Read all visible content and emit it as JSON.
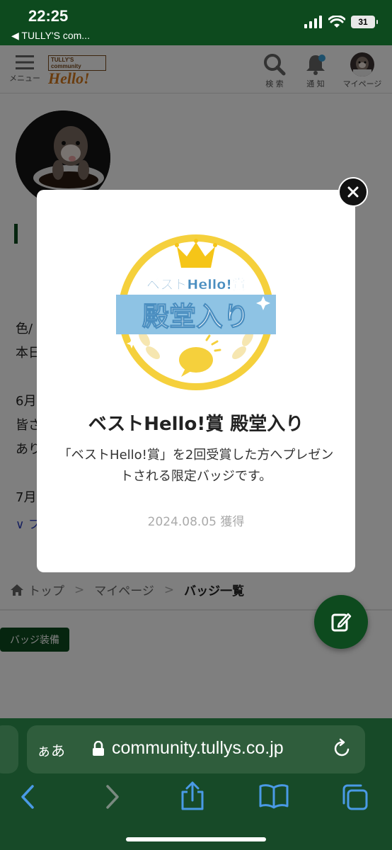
{
  "status_bar": {
    "time": "22:25",
    "back_app": "◀ TULLY'S com...",
    "battery": "31"
  },
  "appbar": {
    "menu_label": "メニュー",
    "logo_top": "TULLY'S community",
    "logo_main": "Hello!",
    "search_label": "検 索",
    "notify_label": "通 知",
    "mypage_label": "マイページ"
  },
  "post": {
    "line1": "色/",
    "line2": "本日",
    "line3": "6月",
    "line4": "皆さ",
    "line5": "あり",
    "line6": "7月",
    "more": "∨ フ"
  },
  "breadcrumb": {
    "home": "トップ",
    "mypage": "マイページ",
    "current": "バッジ一覧",
    "sep": ">"
  },
  "equip_button": "バッジ装備",
  "modal": {
    "badge_top": "ベストHello!賞",
    "badge_main": "殿堂入り",
    "title": "ベストHello!賞 殿堂入り",
    "description": "「ベストHello!賞」を2回受賞した方へプレゼントされる限定バッジです。",
    "date": "2024.08.05 獲得"
  },
  "browser": {
    "aa": "ぁあ",
    "url": "community.tullys.co.jp"
  },
  "colors": {
    "brand_green": "#0d4a1e",
    "badge_yellow": "#f5d03c",
    "badge_blue": "#8ec3e4"
  }
}
